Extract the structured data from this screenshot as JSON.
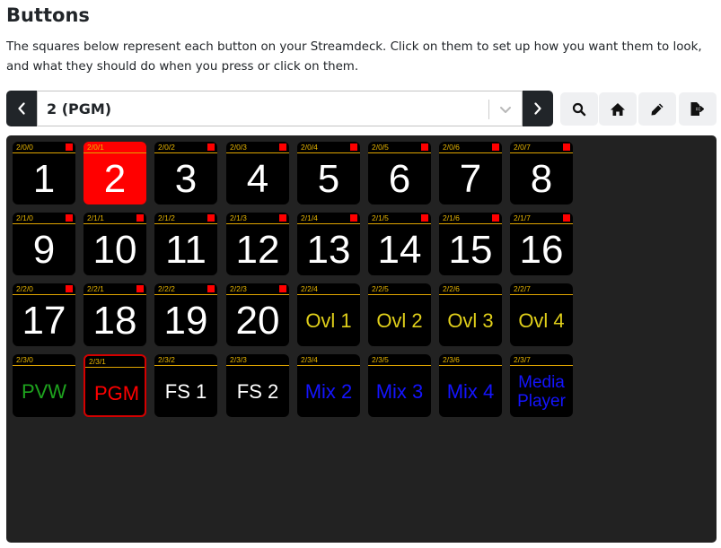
{
  "header": {
    "title": "Buttons",
    "description": "The squares below represent each button on your Streamdeck. Click on them to set up how you want them to look, and what they should do when you press or click on them."
  },
  "pager": {
    "current_page": "2 (PGM)",
    "prev_icon": "chevron-left-icon",
    "next_icon": "chevron-right-icon",
    "dropdown_icon": "chevron-down-icon"
  },
  "toolbar": {
    "icons": [
      "search-icon",
      "home-icon",
      "pencil-icon",
      "export-icon"
    ]
  },
  "colors": {
    "panel_bg": "#222222",
    "key_bg": "#000000",
    "tally": "#ff0000",
    "header_line": "#e0a500",
    "white": "#ffffff",
    "yellow": "#e0cf1a",
    "green": "#1ea31e",
    "red": "#ff0000",
    "blue": "#1414ff"
  },
  "keys": [
    [
      {
        "loc": "2/0/0",
        "label": "1",
        "size": "big",
        "color": "white",
        "tally": true,
        "style": ""
      },
      {
        "loc": "2/0/1",
        "label": "2",
        "size": "big",
        "color": "white",
        "tally": true,
        "style": "red-bg"
      },
      {
        "loc": "2/0/2",
        "label": "3",
        "size": "big",
        "color": "white",
        "tally": true,
        "style": ""
      },
      {
        "loc": "2/0/3",
        "label": "4",
        "size": "big",
        "color": "white",
        "tally": true,
        "style": ""
      },
      {
        "loc": "2/0/4",
        "label": "5",
        "size": "big",
        "color": "white",
        "tally": true,
        "style": ""
      },
      {
        "loc": "2/0/5",
        "label": "6",
        "size": "big",
        "color": "white",
        "tally": true,
        "style": ""
      },
      {
        "loc": "2/0/6",
        "label": "7",
        "size": "big",
        "color": "white",
        "tally": true,
        "style": ""
      },
      {
        "loc": "2/0/7",
        "label": "8",
        "size": "big",
        "color": "white",
        "tally": true,
        "style": ""
      }
    ],
    [
      {
        "loc": "2/1/0",
        "label": "9",
        "size": "big",
        "color": "white",
        "tally": true,
        "style": ""
      },
      {
        "loc": "2/1/1",
        "label": "10",
        "size": "big",
        "color": "white",
        "tally": true,
        "style": ""
      },
      {
        "loc": "2/1/2",
        "label": "11",
        "size": "big",
        "color": "white",
        "tally": true,
        "style": ""
      },
      {
        "loc": "2/1/3",
        "label": "12",
        "size": "big",
        "color": "white",
        "tally": true,
        "style": ""
      },
      {
        "loc": "2/1/4",
        "label": "13",
        "size": "big",
        "color": "white",
        "tally": true,
        "style": ""
      },
      {
        "loc": "2/1/5",
        "label": "14",
        "size": "big",
        "color": "white",
        "tally": true,
        "style": ""
      },
      {
        "loc": "2/1/6",
        "label": "15",
        "size": "big",
        "color": "white",
        "tally": true,
        "style": ""
      },
      {
        "loc": "2/1/7",
        "label": "16",
        "size": "big",
        "color": "white",
        "tally": true,
        "style": ""
      }
    ],
    [
      {
        "loc": "2/2/0",
        "label": "17",
        "size": "big",
        "color": "white",
        "tally": true,
        "style": ""
      },
      {
        "loc": "2/2/1",
        "label": "18",
        "size": "big",
        "color": "white",
        "tally": true,
        "style": ""
      },
      {
        "loc": "2/2/2",
        "label": "19",
        "size": "big",
        "color": "white",
        "tally": true,
        "style": ""
      },
      {
        "loc": "2/2/3",
        "label": "20",
        "size": "big",
        "color": "white",
        "tally": true,
        "style": ""
      },
      {
        "loc": "2/2/4",
        "label": "Ovl 1",
        "size": "mid",
        "color": "yellow",
        "tally": false,
        "style": ""
      },
      {
        "loc": "2/2/5",
        "label": "Ovl 2",
        "size": "mid",
        "color": "yellow",
        "tally": false,
        "style": ""
      },
      {
        "loc": "2/2/6",
        "label": "Ovl 3",
        "size": "mid",
        "color": "yellow",
        "tally": false,
        "style": ""
      },
      {
        "loc": "2/2/7",
        "label": "Ovl 4",
        "size": "mid",
        "color": "yellow",
        "tally": false,
        "style": ""
      }
    ],
    [
      {
        "loc": "2/3/0",
        "label": "PVW",
        "size": "mid",
        "color": "green",
        "tally": false,
        "style": ""
      },
      {
        "loc": "2/3/1",
        "label": "PGM",
        "size": "mid",
        "color": "red",
        "tally": false,
        "style": "red-border"
      },
      {
        "loc": "2/3/2",
        "label": "FS 1",
        "size": "mid",
        "color": "white",
        "tally": false,
        "style": ""
      },
      {
        "loc": "2/3/3",
        "label": "FS 2",
        "size": "mid",
        "color": "white",
        "tally": false,
        "style": ""
      },
      {
        "loc": "2/3/4",
        "label": "Mix 2",
        "size": "mid",
        "color": "blue",
        "tally": false,
        "style": ""
      },
      {
        "loc": "2/3/5",
        "label": "Mix 3",
        "size": "mid",
        "color": "blue",
        "tally": false,
        "style": ""
      },
      {
        "loc": "2/3/6",
        "label": "Mix 4",
        "size": "mid",
        "color": "blue",
        "tally": false,
        "style": ""
      },
      {
        "loc": "2/3/7",
        "label": "Media Player",
        "size": "small",
        "color": "blue",
        "tally": false,
        "style": ""
      }
    ]
  ]
}
